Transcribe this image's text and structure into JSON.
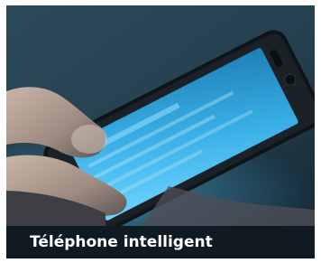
{
  "card": {
    "caption": "Téléphone intelligent"
  },
  "photo": {
    "subject": "hand-holding-smartphone",
    "screen_color": "#3fb8ee",
    "background_color": "#2a4656"
  }
}
